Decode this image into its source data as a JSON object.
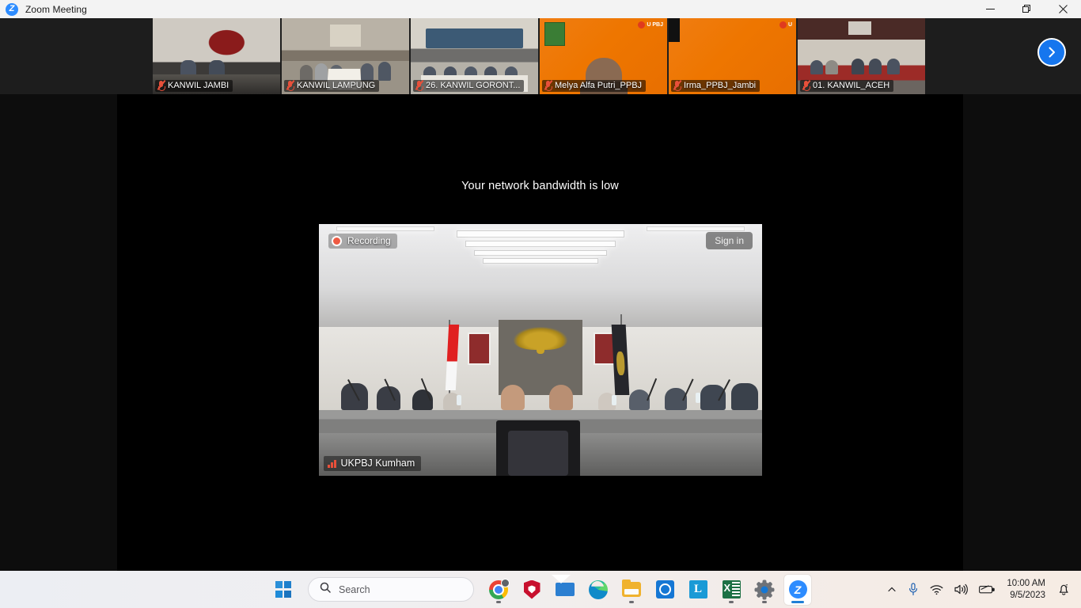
{
  "window": {
    "title": "Zoom Meeting",
    "logo_icon": "zoom-logo-icon",
    "controls": {
      "minimize_icon": "minimize-icon",
      "restore_icon": "restore-icon",
      "close_icon": "close-icon"
    }
  },
  "strip": {
    "next_page_icon": "chevron-right-icon",
    "thumbnails": [
      {
        "name": "KANWIL JAMBI",
        "mic_icon": "mic-muted-icon",
        "scene": "room-a"
      },
      {
        "name": "KANWIL LAMPUNG",
        "mic_icon": "mic-muted-icon",
        "scene": "room-b"
      },
      {
        "name": "26. KANWIL GORONT...",
        "mic_icon": "mic-muted-icon",
        "scene": "room-c"
      },
      {
        "name": "Melya Alfa Putri_PPBJ",
        "mic_icon": "mic-muted-icon",
        "scene": "orange-slide"
      },
      {
        "name": "Irma_PPBJ_Jambi",
        "mic_icon": "mic-muted-icon",
        "scene": "orange-slide"
      },
      {
        "name": "01. KANWIL_ACEH",
        "mic_icon": "mic-muted-icon",
        "scene": "room-d"
      }
    ]
  },
  "stage": {
    "bandwidth_message": "Your network bandwidth is low",
    "recording_label": "Recording",
    "recording_icon": "record-dot-icon",
    "signin_label": "Sign in",
    "speaker_name": "UKPBJ Kumham",
    "signal_icon": "signal-bars-icon"
  },
  "taskbar": {
    "start_icon": "windows-start-icon",
    "search": {
      "placeholder": "Search",
      "icon": "search-icon"
    },
    "apps": [
      {
        "name": "chrome",
        "icon": "chrome-icon",
        "active": false,
        "running": true
      },
      {
        "name": "mcafee",
        "icon": "mcafee-shield-icon",
        "active": false,
        "running": false
      },
      {
        "name": "mail",
        "icon": "mail-icon",
        "active": false,
        "running": false
      },
      {
        "name": "edge",
        "icon": "edge-icon",
        "active": false,
        "running": false
      },
      {
        "name": "explorer",
        "icon": "folder-icon",
        "active": false,
        "running": true
      },
      {
        "name": "office",
        "icon": "office-circle-icon",
        "active": false,
        "running": false
      },
      {
        "name": "lapp",
        "icon": "letter-l-icon",
        "active": false,
        "running": false
      },
      {
        "name": "excel",
        "icon": "excel-icon",
        "active": false,
        "running": true
      },
      {
        "name": "settings",
        "icon": "gear-icon",
        "active": false,
        "running": true
      },
      {
        "name": "zoom",
        "icon": "zoom-icon",
        "active": true,
        "running": true
      }
    ],
    "tray": {
      "overflow_icon": "chevron-up-icon",
      "mic_icon": "microphone-icon",
      "wifi_icon": "wifi-icon",
      "volume_icon": "speaker-icon",
      "battery_icon": "battery-icon",
      "time": "10:00 AM",
      "date": "9/5/2023",
      "notification_icon": "notification-bell-icon"
    }
  },
  "colors": {
    "accent": "#2d8cff",
    "recording": "#ee5a43",
    "taskbar_active": "#1f7fd6"
  }
}
